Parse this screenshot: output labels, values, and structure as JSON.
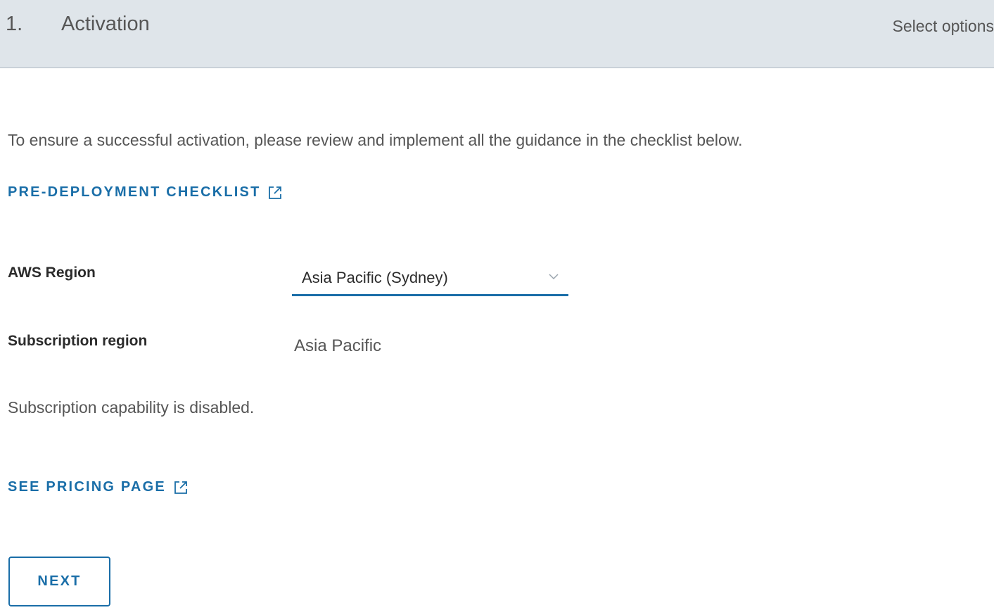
{
  "header": {
    "step_number": "1.",
    "title": "Activation",
    "status": "Select options"
  },
  "intro_text": "To ensure a successful activation, please review and implement all the guidance in the checklist below.",
  "checklist_link": {
    "label": "PRE-DEPLOYMENT CHECKLIST",
    "icon": "external-link-icon"
  },
  "aws_region": {
    "label": "AWS Region",
    "selected": "Asia Pacific (Sydney)",
    "icon": "chevron-down-icon"
  },
  "subscription_region": {
    "label": "Subscription region",
    "value": "Asia Pacific"
  },
  "subscription_note": "Subscription capability is disabled.",
  "pricing_link": {
    "label": "SEE PRICING PAGE",
    "icon": "external-link-icon"
  },
  "next_button": {
    "label": "NEXT"
  },
  "colors": {
    "header_bg": "#dfe5ea",
    "accent": "#1a6ea8",
    "text": "#565656"
  }
}
